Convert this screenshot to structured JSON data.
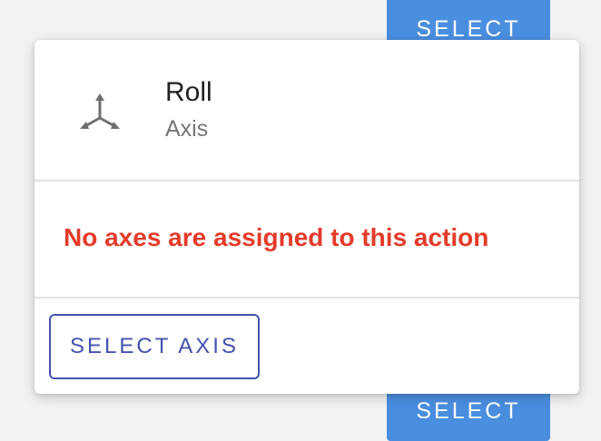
{
  "background": {
    "top_button_label": "SELECT",
    "bottom_button_label": "SELECT",
    "button_color": "#4a8ee0"
  },
  "card": {
    "icon": "axis-3d-icon",
    "title": "Roll",
    "subtitle": "Axis",
    "error_message": "No axes are assigned to this action",
    "error_color": "#e53b2a",
    "action_button_label": "SELECT AXIS",
    "accent_color": "#4451b0"
  }
}
